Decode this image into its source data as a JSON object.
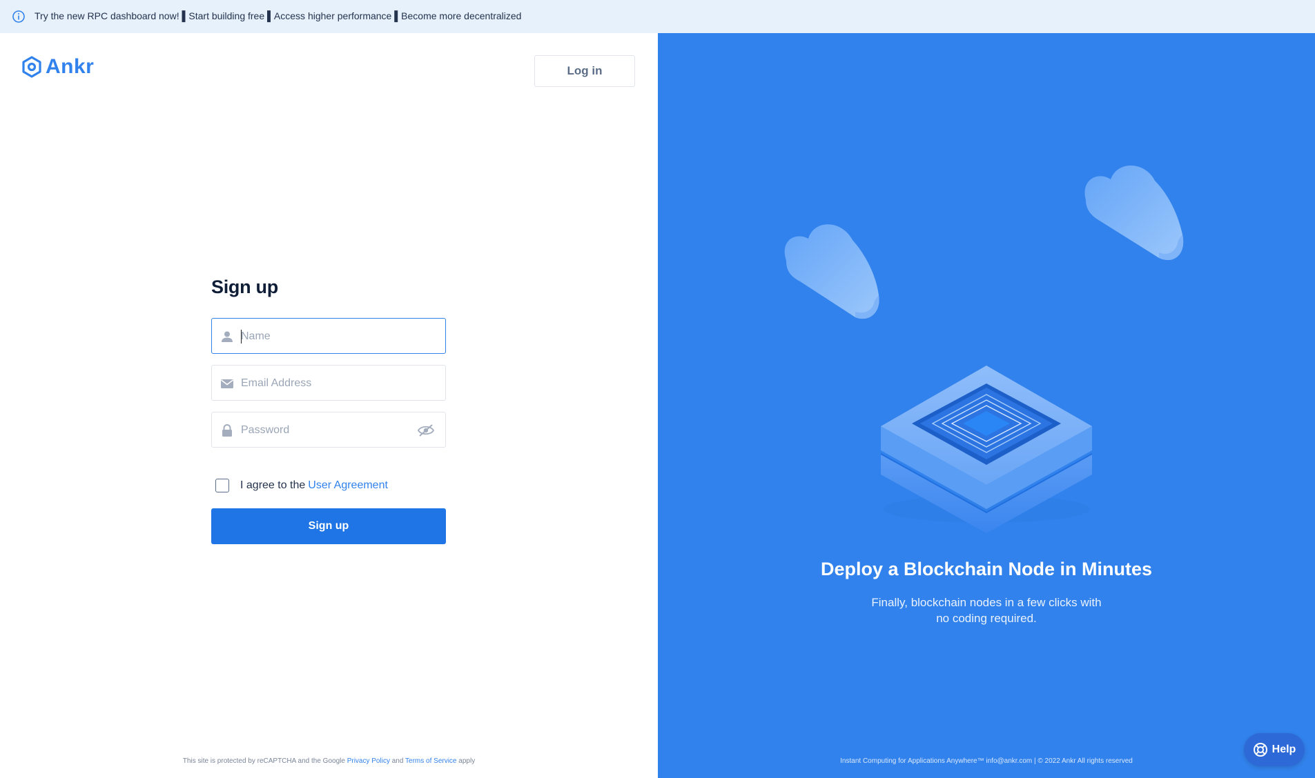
{
  "banner": {
    "text": "Try the new RPC dashboard now! ▌Start building free ▌Access higher performance ▌Become more decentralized"
  },
  "header": {
    "logo_text": "Ankr",
    "login_label": "Log in"
  },
  "form": {
    "title": "Sign up",
    "name_placeholder": "Name",
    "email_placeholder": "Email Address",
    "password_placeholder": "Password",
    "agree_text": "I agree to the",
    "agree_link": "User Agreement",
    "submit_label": "Sign up"
  },
  "recaptcha": {
    "prefix": "This site is protected by reCAPTCHA and the Google",
    "privacy": "Privacy Policy",
    "and": "and",
    "terms": "Terms of Service",
    "suffix": "apply"
  },
  "hero": {
    "title": "Deploy a Blockchain Node in Minutes",
    "subtitle_line1": "Finally, blockchain nodes in a few clicks with",
    "subtitle_line2": "no coding required.",
    "footer": "Instant Computing for Applications Anywhere™ info@ankr.com | © 2022 Ankr All rights reserved"
  },
  "help": {
    "label": "Help"
  },
  "colors": {
    "brand": "#3182ec",
    "button": "#1f75e5",
    "banner_bg": "#e6f1fc"
  },
  "icons": [
    "info-icon",
    "ankr-logo-icon",
    "user-icon",
    "envelope-icon",
    "lock-icon",
    "eye-off-icon",
    "lifebuoy-icon"
  ]
}
